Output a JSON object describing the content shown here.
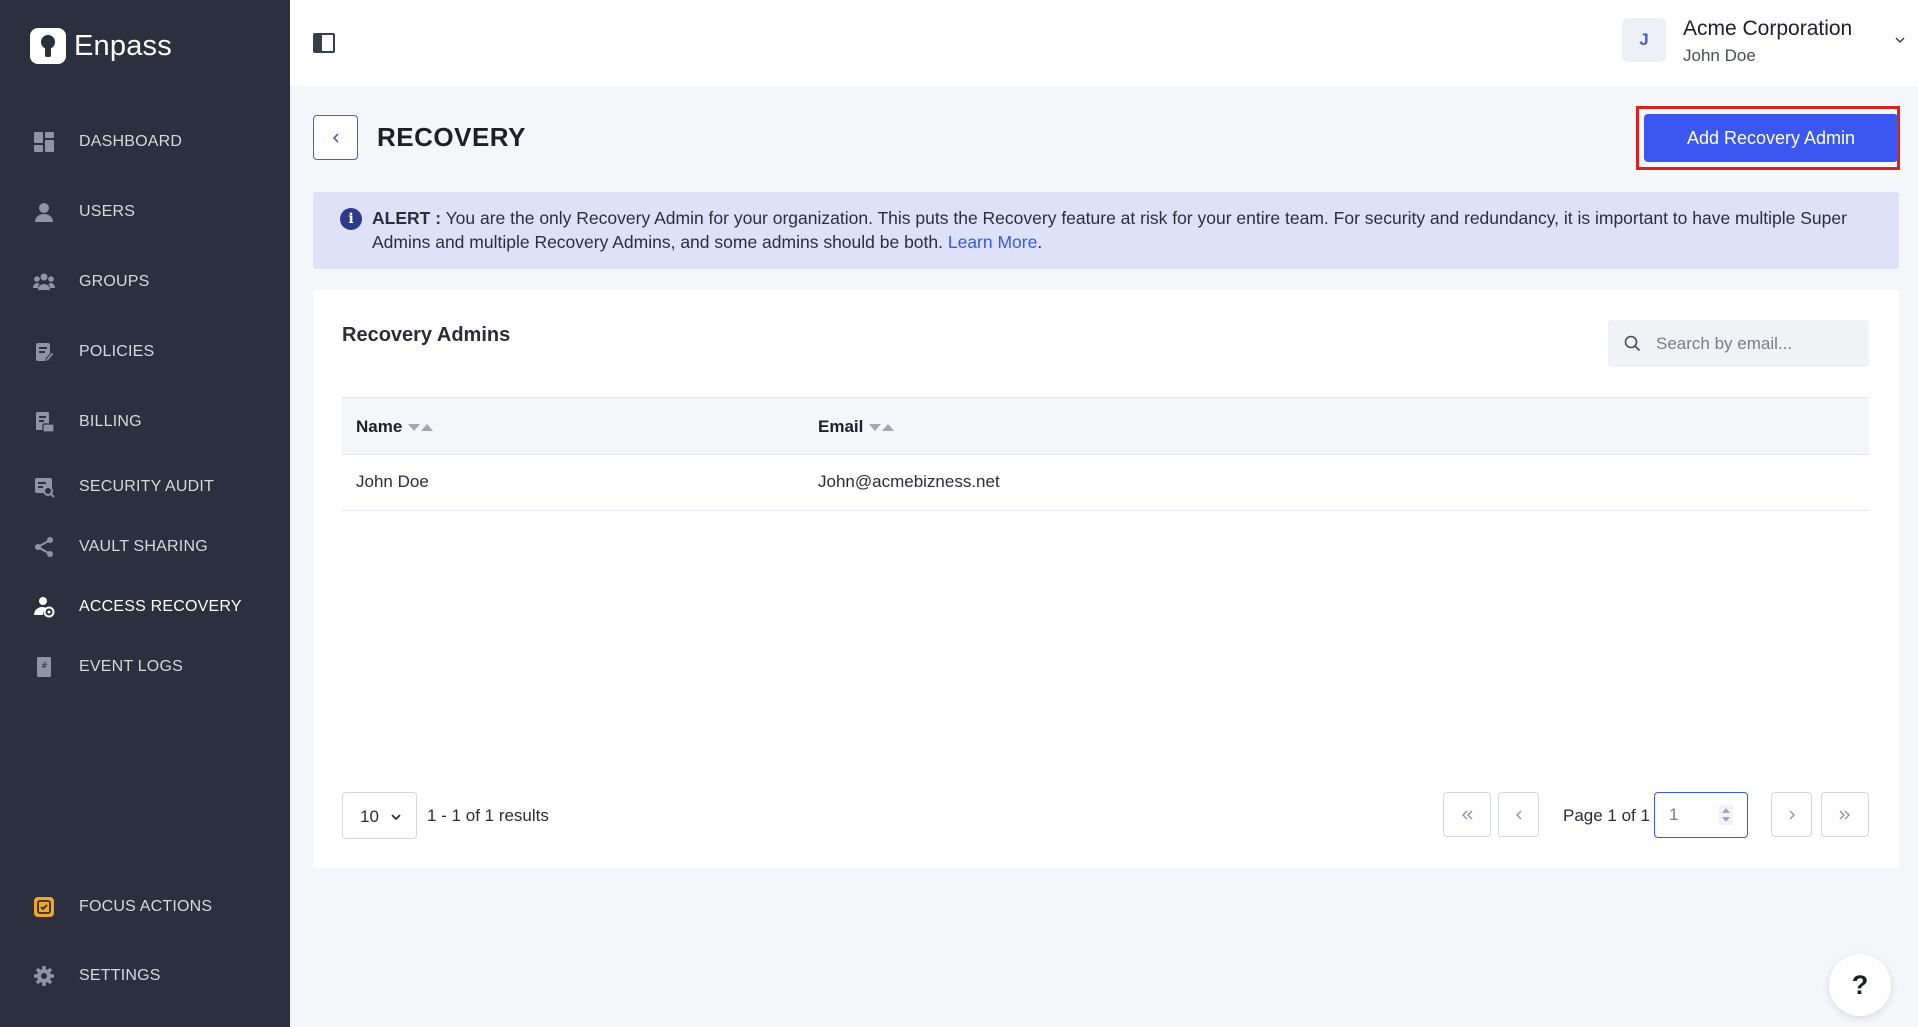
{
  "brand": {
    "name": "Enpass"
  },
  "sidebar": {
    "items": [
      {
        "label": "DASHBOARD",
        "icon": "dashboard-icon"
      },
      {
        "label": "USERS",
        "icon": "user-icon"
      },
      {
        "label": "GROUPS",
        "icon": "groups-icon"
      },
      {
        "label": "POLICIES",
        "icon": "policies-icon"
      },
      {
        "label": "BILLING",
        "icon": "billing-icon"
      },
      {
        "label": "SECURITY AUDIT",
        "icon": "security-audit-icon"
      },
      {
        "label": "VAULT SHARING",
        "icon": "share-icon"
      },
      {
        "label": "ACCESS RECOVERY",
        "icon": "access-recovery-icon",
        "active": true
      },
      {
        "label": "EVENT LOGS",
        "icon": "event-logs-icon"
      }
    ],
    "bottom": [
      {
        "label": "FOCUS ACTIONS",
        "icon": "focus-actions-icon"
      },
      {
        "label": "SETTINGS",
        "icon": "gear-icon"
      }
    ]
  },
  "header": {
    "org_initial": "J",
    "org_name": "Acme Corporation",
    "user_name": "John Doe"
  },
  "page": {
    "title": "RECOVERY",
    "add_button": "Add Recovery Admin"
  },
  "alert": {
    "prefix": "ALERT :",
    "message": " You are the only Recovery Admin for your organization. This puts the Recovery feature at risk for your entire team. For security and redundancy, it is important to have multiple Super Admins and multiple Recovery Admins, and some admins should be both. ",
    "link": "Learn More",
    "suffix": "."
  },
  "table": {
    "title": "Recovery Admins",
    "search_placeholder": "Search by email...",
    "columns": [
      "Name",
      "Email"
    ],
    "rows": [
      {
        "name": "John Doe",
        "email": "John@acmebizness.net"
      }
    ]
  },
  "pagination": {
    "page_size": "10",
    "results": "1 - 1 of 1 results",
    "page_label": "Page 1 of 1",
    "current_page": "1"
  },
  "help": {
    "label": "?"
  },
  "colors": {
    "sidebar_bg": "#2c2f3e",
    "primary": "#3a57f2",
    "alert_bg": "#dde2f8",
    "highlight": "#e01e1e",
    "focus_accent": "#f5a524"
  }
}
